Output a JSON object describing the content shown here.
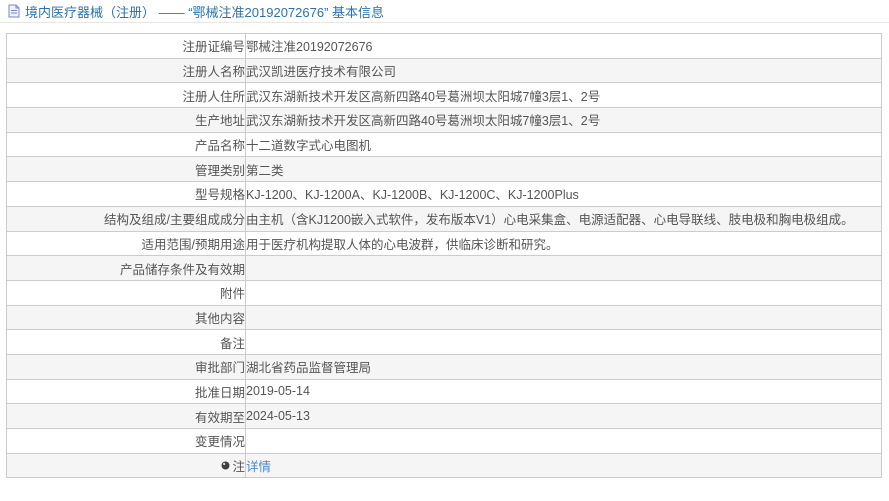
{
  "header": {
    "title": "境内医疗器械（注册） —— “鄂械注准20192072676” 基本信息"
  },
  "table": {
    "rows": [
      {
        "label": "注册证编号",
        "value": "鄂械注准20192072676"
      },
      {
        "label": "注册人名称",
        "value": "武汉凯进医疗技术有限公司"
      },
      {
        "label": "注册人住所",
        "value": "武汉东湖新技术开发区高新四路40号葛洲坝太阳城7幢3层1、2号"
      },
      {
        "label": "生产地址",
        "value": "武汉东湖新技术开发区高新四路40号葛洲坝太阳城7幢3层1、2号"
      },
      {
        "label": "产品名称",
        "value": "十二道数字式心电图机"
      },
      {
        "label": "管理类别",
        "value": "第二类"
      },
      {
        "label": "型号规格",
        "value": "KJ-1200、KJ-1200A、KJ-1200B、KJ-1200C、KJ-1200Plus"
      },
      {
        "label": "结构及组成/主要组成成分",
        "value": "由主机（含KJ1200嵌入式软件，发布版本V1）心电采集盒、电源适配器、心电导联线、肢电极和胸电极组成。"
      },
      {
        "label": "适用范围/预期用途",
        "value": "用于医疗机构提取人体的心电波群，供临床诊断和研究。"
      },
      {
        "label": "产品储存条件及有效期",
        "value": ""
      },
      {
        "label": "附件",
        "value": ""
      },
      {
        "label": "其他内容",
        "value": ""
      },
      {
        "label": "备注",
        "value": ""
      },
      {
        "label": "审批部门",
        "value": "湖北省药品监督管理局"
      },
      {
        "label": "批准日期",
        "value": "2019-05-14"
      },
      {
        "label": "有效期至",
        "value": "2024-05-13"
      },
      {
        "label": "变更情况",
        "value": ""
      },
      {
        "label": "注",
        "value": "详情"
      }
    ]
  },
  "colors": {
    "header_text": "#2a72ad",
    "link": "#4a88d0",
    "row_alt": "#f5f5f5",
    "border": "#cccccc",
    "cell_text": "#555555"
  }
}
